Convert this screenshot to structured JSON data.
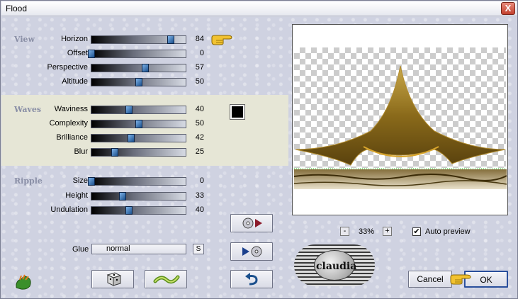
{
  "window": {
    "title": "Flood",
    "close_label": "X"
  },
  "groups": {
    "view": "View",
    "waves": "Waves",
    "ripple": "Ripple"
  },
  "sliders": [
    {
      "label": "Horizon",
      "value": 84,
      "level": 0.84
    },
    {
      "label": "Offset",
      "value": 0,
      "level": 0.0
    },
    {
      "label": "Perspective",
      "value": 57,
      "level": 0.57
    },
    {
      "label": "Altitude",
      "value": 50,
      "level": 0.5
    },
    {
      "label": "Waviness",
      "value": 40,
      "level": 0.4
    },
    {
      "label": "Complexity",
      "value": 50,
      "level": 0.5
    },
    {
      "label": "Brilliance",
      "value": 42,
      "level": 0.42
    },
    {
      "label": "Blur",
      "value": 25,
      "level": 0.25
    },
    {
      "label": "Size",
      "value": 0,
      "level": 0.0
    },
    {
      "label": "Height",
      "value": 33,
      "level": 0.33
    },
    {
      "label": "Undulation",
      "value": 40,
      "level": 0.4
    }
  ],
  "wave_color": "#000000",
  "glue": {
    "label": "Glue",
    "value": "normal",
    "s_button": "S"
  },
  "zoom": {
    "minus": "-",
    "value": "33%",
    "plus": "+"
  },
  "auto_preview": {
    "label": "Auto preview",
    "checked": true,
    "mark": "✔"
  },
  "buttons": {
    "cancel": "Cancel",
    "ok": "OK"
  },
  "logo_text": "claudia",
  "colors": {
    "accent": "#1a4f8c",
    "shape": "#8a6a1a",
    "waves_band": "#e6e6d6"
  },
  "icons": [
    "close-icon",
    "hand-pointer-icon",
    "cd-play-icon",
    "play-cd-icon",
    "dice-icon",
    "wave-icon",
    "undo-icon",
    "plugin-logo-icon"
  ]
}
